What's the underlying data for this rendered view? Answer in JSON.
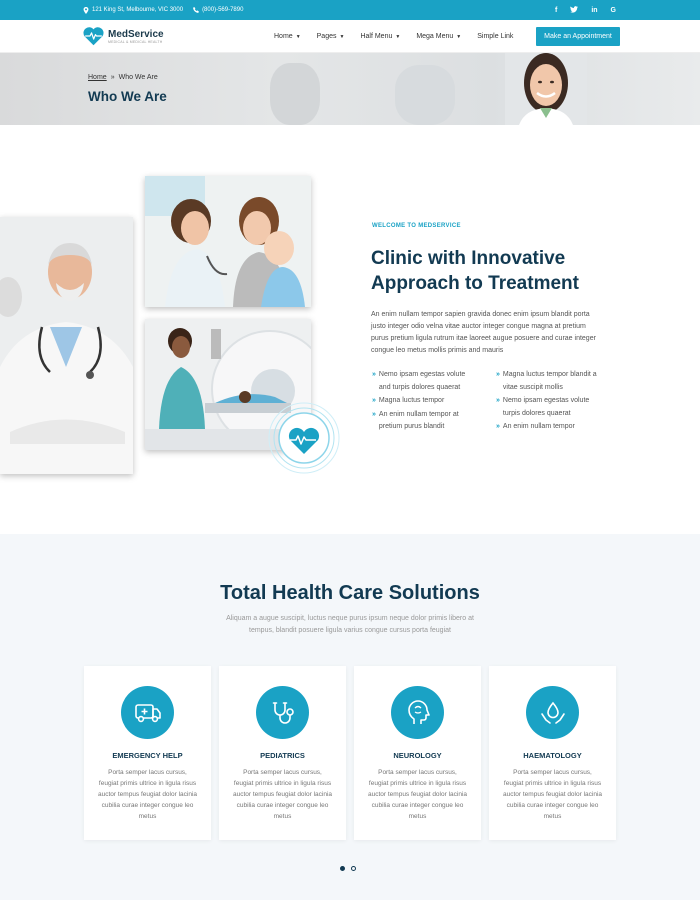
{
  "topbar": {
    "address": "121 King St, Melbourne, VIC 3000",
    "phone": "(800)-569-7890",
    "address_icon": "map-pin-icon",
    "phone_icon": "phone-icon",
    "social": [
      {
        "name": "facebook-icon",
        "glyph": "f"
      },
      {
        "name": "twitter-icon",
        "glyph": "t"
      },
      {
        "name": "linkedin-icon",
        "glyph": "in"
      },
      {
        "name": "google-icon",
        "glyph": "G"
      }
    ]
  },
  "header": {
    "logo_name": "MedService",
    "logo_tagline": "MEDICAL & MEDICAL HEALTH",
    "nav": [
      {
        "label": "Home",
        "dropdown": true
      },
      {
        "label": "Pages",
        "dropdown": true
      },
      {
        "label": "Half Menu",
        "dropdown": true
      },
      {
        "label": "Mega Menu",
        "dropdown": true
      },
      {
        "label": "Simple Link",
        "dropdown": false
      }
    ],
    "cta_label": "Make an Appointment"
  },
  "banner": {
    "breadcrumb_home": "Home",
    "breadcrumb_sep": "»",
    "breadcrumb_current": "Who We Are",
    "title": "Who We Are"
  },
  "about": {
    "eyebrow": "WELCOME TO MEDSERVICE",
    "title": "Clinic with Innovative Approach to Treatment",
    "text": "An enim nullam tempor sapien gravida donec enim ipsum blandit porta justo integer odio velna vitae auctor integer congue magna at pretium purus pretium ligula rutrum itae laoreet augue posuere and curae integer congue leo metus mollis primis and mauris",
    "features_col1": [
      "Nemo ipsam egestas volute and turpis dolores quaerat",
      "Magna luctus tempor",
      "An enim nullam tempor at pretium purus blandit"
    ],
    "features_col2": [
      "Magna luctus tempor blandit a vitae suscipit mollis",
      "Nemo ipsam egestas volute turpis dolores quaerat",
      "An enim nullam tempor"
    ]
  },
  "services": {
    "title": "Total Health Care Solutions",
    "subtitle": "Aliquam a augue suscipit, luctus neque purus ipsum neque dolor primis libero at tempus, blandit posuere ligula varius congue cursus porta feugiat",
    "cards": [
      {
        "title": "EMERGENCY HELP",
        "icon": "ambulance-icon",
        "desc": "Porta semper lacus cursus, feugiat primis ultrice in ligula risus auctor tempus feugiat dolor lacinia cubilia curae integer congue leo metus"
      },
      {
        "title": "PEDIATRICS",
        "icon": "stethoscope-icon",
        "desc": "Porta semper lacus cursus, feugiat primis ultrice in ligula risus auctor tempus feugiat dolor lacinia cubilia curae integer congue leo metus"
      },
      {
        "title": "NEUROLOGY",
        "icon": "head-profile-icon",
        "desc": "Porta semper lacus cursus, feugiat primis ultrice in ligula risus auctor tempus feugiat dolor lacinia cubilia curae integer congue leo metus"
      },
      {
        "title": "HAEMATOLOGY",
        "icon": "blood-drop-hands-icon",
        "desc": "Porta semper lacus cursus, feugiat primis ultrice in ligula risus auctor tempus feugiat dolor lacinia cubilia curae integer congue leo metus"
      }
    ],
    "pagination": {
      "pages": 2,
      "current": 1
    }
  },
  "colors": {
    "accent": "#1aa2c5",
    "heading": "#123a52",
    "section_bg": "#f4f7fa"
  }
}
